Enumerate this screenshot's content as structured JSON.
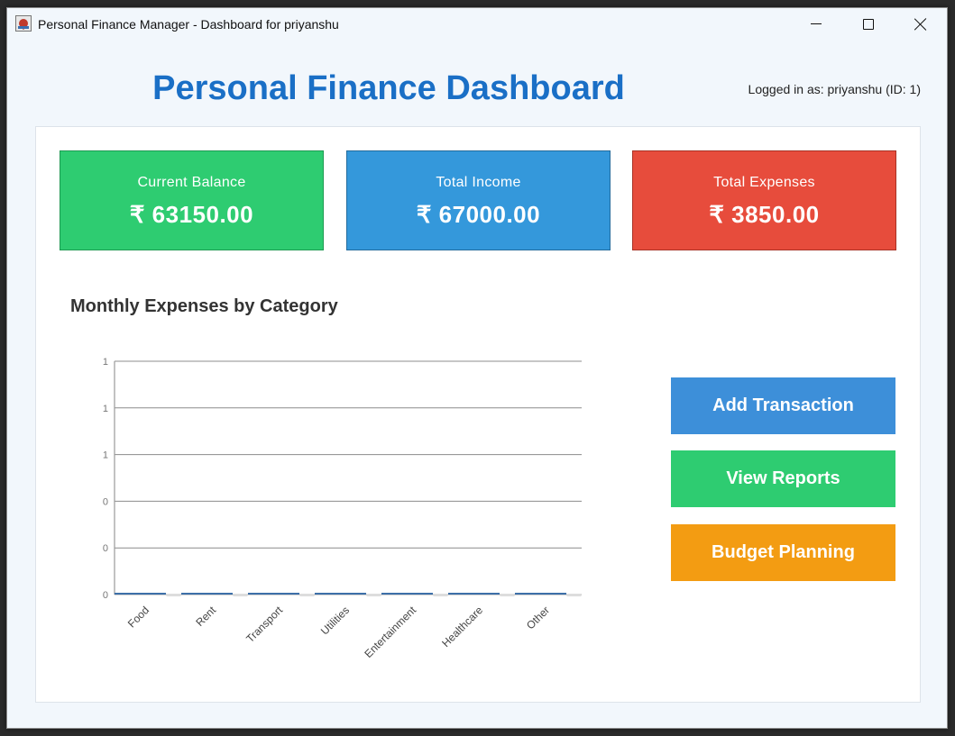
{
  "window": {
    "title": "Personal Finance Manager - Dashboard for priyanshu"
  },
  "header": {
    "title": "Personal Finance Dashboard",
    "login_info": "Logged in as: priyanshu (ID: 1)"
  },
  "cards": {
    "balance": {
      "label": "Current Balance",
      "value": "₹ 63150.00",
      "color": "#2ecc71"
    },
    "income": {
      "label": "Total Income",
      "value": "₹ 67000.00",
      "color": "#3498db"
    },
    "expenses": {
      "label": "Total Expenses",
      "value": "₹ 3850.00",
      "color": "#e74c3c"
    }
  },
  "chart": {
    "title": "Monthly Expenses by Category"
  },
  "chart_data": {
    "type": "bar",
    "title": "Monthly Expenses by Category",
    "categories": [
      "Food",
      "Rent",
      "Transport",
      "Utilities",
      "Entertainment",
      "Healthcare",
      "Other"
    ],
    "values": [
      0,
      0,
      0,
      0,
      0,
      0,
      0
    ],
    "ytick_labels": [
      "0",
      "0",
      "0",
      "1",
      "1",
      "1"
    ],
    "ylim": [
      0,
      1
    ],
    "grid": true,
    "bar_color": "#3d6fa8"
  },
  "actions": {
    "add_transaction": "Add Transaction",
    "view_reports": "View Reports",
    "budget_planning": "Budget Planning"
  }
}
